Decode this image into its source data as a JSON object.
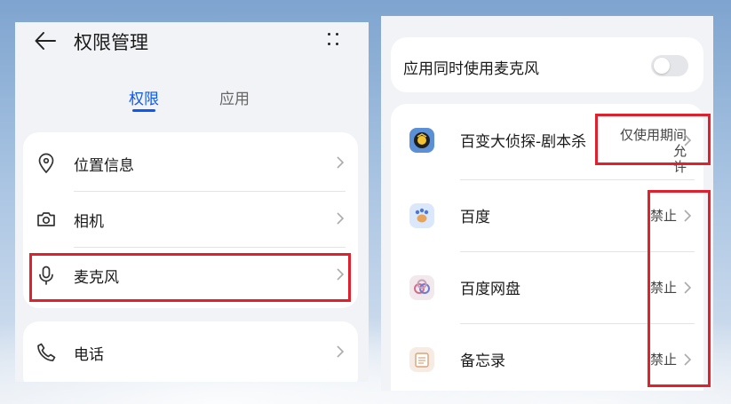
{
  "left": {
    "title": "权限管理",
    "tabs": [
      {
        "label": "权限",
        "active": true
      },
      {
        "label": "应用",
        "active": false
      }
    ],
    "permissions": [
      {
        "label": "位置信息",
        "icon": "location-icon"
      },
      {
        "label": "相机",
        "icon": "camera-icon"
      },
      {
        "label": "麦克风",
        "icon": "microphone-icon",
        "highlighted": true
      },
      {
        "label": "电话",
        "icon": "phone-icon"
      }
    ]
  },
  "right": {
    "toggle": {
      "label": "应用同时使用麦克风",
      "on": false
    },
    "apps": [
      {
        "name": "百变大侦探-剧本杀",
        "status": "仅使用期间允许",
        "status_line1": "仅使用期间允",
        "status_line2": "许",
        "icon": "detective-app-icon"
      },
      {
        "name": "百度",
        "status": "禁止",
        "icon": "baidu-app-icon"
      },
      {
        "name": "百度网盘",
        "status": "禁止",
        "icon": "baidu-netdisk-app-icon"
      },
      {
        "name": "备忘录",
        "status": "禁止",
        "icon": "notes-app-icon"
      }
    ]
  },
  "colors": {
    "accent": "#0a59f7",
    "highlight": "#e0202c"
  }
}
